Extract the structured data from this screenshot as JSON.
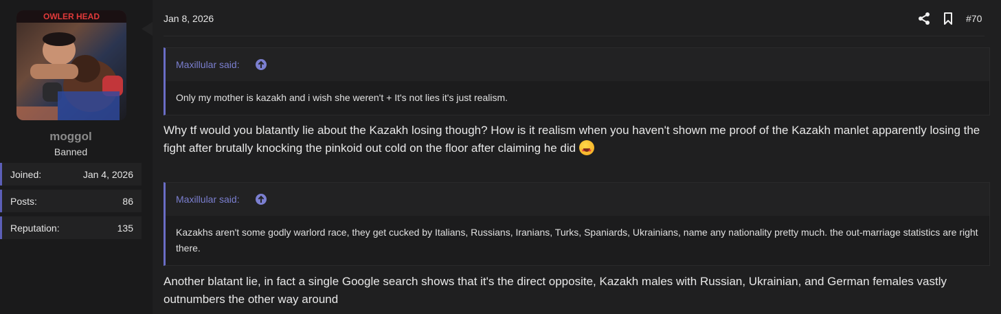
{
  "user": {
    "name": "moggol",
    "title": "Banned",
    "stats": [
      {
        "label": "Joined:",
        "value": "Jan 4, 2026"
      },
      {
        "label": "Posts:",
        "value": "86"
      },
      {
        "label": "Reputation:",
        "value": "135"
      }
    ]
  },
  "post": {
    "date": "Jan 8, 2026",
    "number": "#70",
    "quotes": [
      {
        "author": "Maxillular said:",
        "text": "Only my mother is kazakh and i wish she weren't + It's not lies it's just realism."
      },
      {
        "author": "Maxillular said:",
        "text": "Kazakhs aren't some godly warlord race, they get cucked by Italians, Russians, Iranians, Turks, Spaniards, Ukrainians, name any nationality pretty much. the out-marriage statistics are right there."
      }
    ],
    "replies": [
      "Why tf would you blatantly lie about the Kazakh losing though? How is it realism when you haven't shown me proof of the Kazakh manlet apparently losing the fight after brutally knocking the pinkoid out cold on the floor after claiming he did",
      "Another blatant lie, in fact a single Google search shows that it's the direct opposite, Kazakh males with Russian, Ukrainian, and German females vastly outnumbers the other way around"
    ]
  },
  "avatar_text": "OWLER HEAD",
  "icons": {
    "share": "share-icon",
    "bookmark": "bookmark-icon",
    "quote_jump": "arrow-up-circle-icon",
    "emoji": "star-struck-emoji"
  },
  "colors": {
    "accent": "#6a6dc6",
    "quote_author": "#7b7fd0",
    "username": "#8a8a8a"
  }
}
